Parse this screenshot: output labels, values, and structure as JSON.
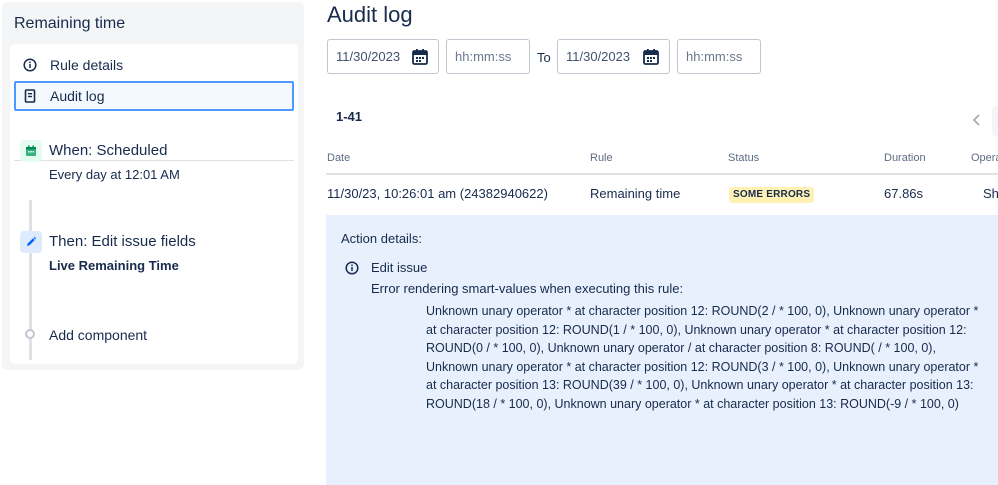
{
  "sidebar": {
    "title": "Remaining time",
    "nav": [
      {
        "label": "Rule details",
        "icon": "info-icon"
      },
      {
        "label": "Audit log",
        "icon": "document-icon"
      }
    ],
    "trigger": {
      "title": "When: Scheduled",
      "subtitle": "Every day at 12:01 AM",
      "icon": "calendar-icon",
      "color": "#36b37e"
    },
    "action": {
      "title": "Then: Edit issue fields",
      "subtitle": "Live Remaining Time",
      "icon": "pencil-icon",
      "color": "#0065ff"
    },
    "add_component": "Add component"
  },
  "main": {
    "title": "Audit log",
    "filters": {
      "from_date": "11/30/2023",
      "from_time_placeholder": "hh:mm:ss",
      "to_label": "To",
      "to_date": "11/30/2023",
      "to_time_placeholder": "hh:mm:ss"
    },
    "range": "1-41",
    "columns": [
      "Date",
      "Rule",
      "Status",
      "Duration",
      "Opera"
    ],
    "row": {
      "date": "11/30/23, 10:26:01 am (24382940622)",
      "rule": "Remaining time",
      "status": "SOME ERRORS",
      "duration": "67.86s",
      "operation": "Sh"
    },
    "details": {
      "title": "Action details:",
      "action": "Edit issue",
      "error_heading": "Error rendering smart-values when executing this rule:",
      "error_lines": [
        "Unknown unary operator * at character position 12: ROUND(2 / * 100, 0), Unknown unary operator *",
        "at character position 12: ROUND(1 / * 100, 0), Unknown unary operator * at character position 12:",
        "ROUND(0 / * 100, 0), Unknown unary operator / at character position 8: ROUND( / * 100, 0),",
        "Unknown unary operator * at character position 12: ROUND(3 / * 100, 0), Unknown unary operator *",
        "at character position 13: ROUND(39 / * 100, 0), Unknown unary operator * at character position 13:",
        "ROUND(18 / * 100, 0), Unknown unary operator * at character position 13: ROUND(-9 / * 100, 0)"
      ]
    }
  },
  "colors": {
    "accent": "#4c9aff",
    "status_badge_bg": "#fff0b3",
    "details_bg": "#e8f0fd"
  }
}
